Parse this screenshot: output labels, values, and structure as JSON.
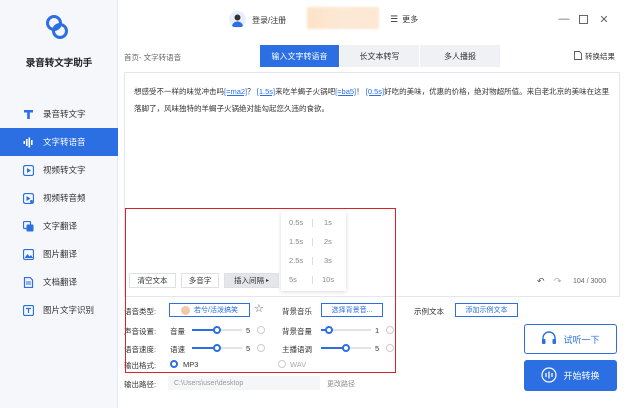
{
  "app": {
    "title": "录音转文字助手"
  },
  "nav": {
    "items": [
      {
        "label": "录音转文字",
        "icon": "text-t-icon"
      },
      {
        "label": "文字转语音",
        "icon": "audio-wave-icon",
        "active": true
      },
      {
        "label": "视频转文字",
        "icon": "video-play-icon"
      },
      {
        "label": "视频转音频",
        "icon": "video-audio-icon"
      },
      {
        "label": "文字翻译",
        "icon": "translate-icon"
      },
      {
        "label": "图片翻译",
        "icon": "image-translate-icon"
      },
      {
        "label": "文档翻译",
        "icon": "doc-translate-icon"
      },
      {
        "label": "图片文字识别",
        "icon": "image-ocr-icon"
      }
    ]
  },
  "topbar": {
    "login": "登录/注册",
    "more": "更多"
  },
  "breadcrumb": "首页- 文字转语音",
  "tabs": [
    {
      "label": "输入文字转语音",
      "active": true
    },
    {
      "label": "长文本转写",
      "active": false
    },
    {
      "label": "多人播报",
      "active": false
    }
  ],
  "convert_result": "转换结果",
  "editor": {
    "seg1": "想感受不一样的味觉冲击吗",
    "tag1": "[=ma2]",
    "seg2": "？",
    "tag2": "[1.5s]",
    "seg3": "来吃羊蝎子火锅吧",
    "tag3": "[=ba5]",
    "seg4": "！",
    "tag4": "[0.5s]",
    "seg5": "好吃的美味，优惠的价格，绝对物超所值。来自老北京的美味在这里落脚了，风味独特的羊蝎子火锅绝对能勾起您久违的食欲。",
    "clear_btn": "清空文本",
    "polyphone_btn": "多音字",
    "pause_btn": "插入间隔",
    "count": "104 / 3000"
  },
  "pause_options": [
    "0.5s",
    "1s",
    "1.5s",
    "2s",
    "2.5s",
    "3s",
    "5s",
    "10s"
  ],
  "settings": {
    "voice_type_label": "语音类型:",
    "voice_name": "若兮/活泼搞笑",
    "bg_music_label": "背景音乐",
    "bg_music_btn": "选择背景音...",
    "sample_text_label": "示例文本",
    "sample_text_btn": "添加示例文本",
    "sound_settings_label": "声音设置:",
    "volume_label": "音量",
    "volume_value": "5",
    "volume_level": 0.5,
    "bg_volume_label": "背景音量",
    "bg_volume_value": "1",
    "bg_volume_level": 0.1,
    "speed_label": "语音速度:",
    "speed_sub": "语速",
    "speed_value": "5",
    "speed_level": 0.5,
    "pitch_label": "主播语调",
    "pitch_value": "5",
    "pitch_level": 0.5,
    "format_label": "输出格式:",
    "format_mp3": "MP3",
    "format_wav": "WAV",
    "path_label": "输出路径:",
    "path_value": "C:\\Users\\user\\desktop",
    "path_change": "更改路径",
    "listen_btn": "试听一下",
    "start_btn": "开始转换"
  },
  "colors": {
    "accent": "#2b6fe3",
    "highlight": "#d9232a"
  }
}
